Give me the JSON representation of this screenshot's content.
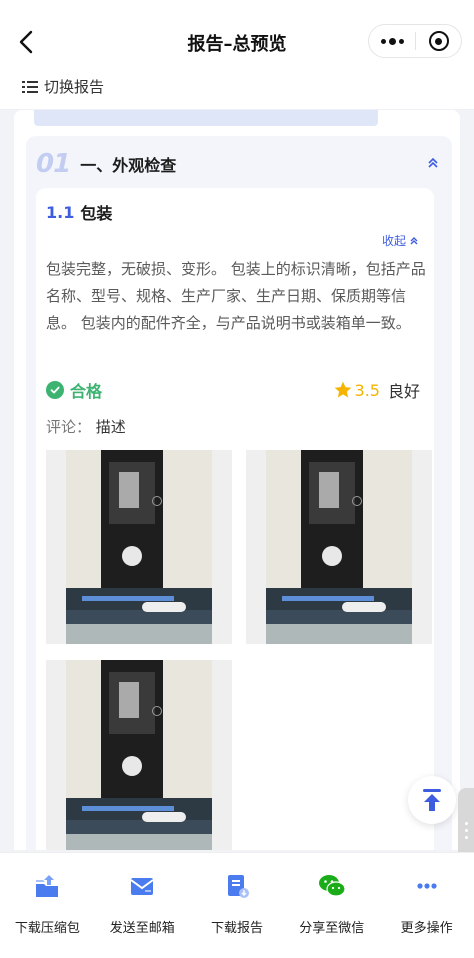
{
  "navbar": {
    "title": "报告–总预览"
  },
  "switch": {
    "label": "切换报告"
  },
  "section": {
    "number": "01",
    "title": "一、外观检查",
    "item": {
      "number": "1.1",
      "name": "包装",
      "collapse_label": "收起",
      "description": "包装完整，无破损、变形。 包装上的标识清晰，包括产品名称、型号、规格、生产厂家、生产日期、保质期等信息。 包装内的配件齐全，与产品说明书或装箱单一致。",
      "status": "合格",
      "rating_score": "3.5",
      "rating_text": "良好",
      "comment_label": "评论：",
      "comment_value": "描述",
      "photo_count": 3
    }
  },
  "toolbar": {
    "items": [
      {
        "label": "下载压缩包",
        "icon": "download-archive-icon"
      },
      {
        "label": "发送至邮箱",
        "icon": "mail-icon"
      },
      {
        "label": "下载报告",
        "icon": "download-report-icon"
      },
      {
        "label": "分享至微信",
        "icon": "wechat-icon"
      },
      {
        "label": "更多操作",
        "icon": "more-icon"
      }
    ]
  },
  "colors": {
    "accent": "#3d5ce0",
    "success": "#3cb371",
    "star": "#f5b400",
    "wechat": "#1aad19"
  }
}
